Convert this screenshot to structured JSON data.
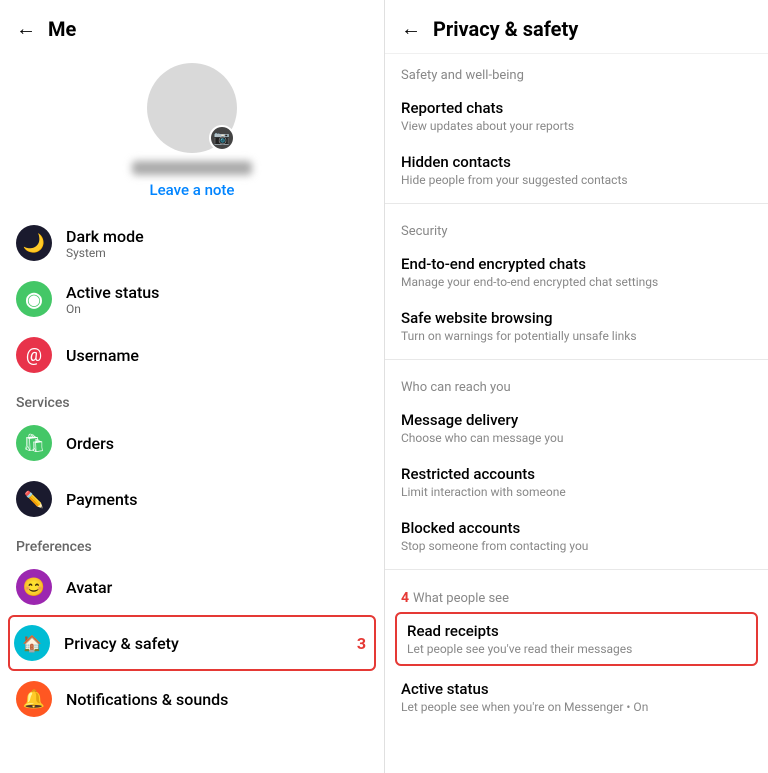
{
  "left": {
    "back_label": "←",
    "title": "Me",
    "leave_note": "Leave a note",
    "items": [
      {
        "id": "dark-mode",
        "title": "Dark mode",
        "sub": "System",
        "icon": "🌙",
        "icon_class": "icon-dark"
      },
      {
        "id": "active-status",
        "title": "Active status",
        "sub": "On",
        "icon": "⊙",
        "icon_class": "icon-green"
      },
      {
        "id": "username",
        "title": "Username",
        "sub": "",
        "icon": "@",
        "icon_class": "icon-red"
      }
    ],
    "sections": {
      "services": {
        "label": "Services",
        "items": [
          {
            "id": "orders",
            "title": "Orders",
            "sub": "",
            "icon": "🛍",
            "icon_class": "icon-shop"
          },
          {
            "id": "payments",
            "title": "Payments",
            "sub": "",
            "icon": "✏",
            "icon_class": "icon-pay"
          }
        ]
      },
      "preferences": {
        "label": "Preferences",
        "items": [
          {
            "id": "avatar",
            "title": "Avatar",
            "sub": "",
            "icon": "😊",
            "icon_class": "icon-avatar"
          },
          {
            "id": "privacy",
            "title": "Privacy & safety",
            "sub": "",
            "icon": "🏠",
            "icon_class": "icon-privacy",
            "highlighted": true,
            "step": "3"
          },
          {
            "id": "notifications",
            "title": "Notifications & sounds",
            "sub": "",
            "icon": "🔔",
            "icon_class": "icon-notif"
          }
        ]
      }
    }
  },
  "right": {
    "back_label": "←",
    "title": "Privacy & safety",
    "sections": [
      {
        "id": "safety",
        "label": "Safety and well-being",
        "items": [
          {
            "id": "reported-chats",
            "title": "Reported chats",
            "sub": "View updates about your reports"
          },
          {
            "id": "hidden-contacts",
            "title": "Hidden contacts",
            "sub": "Hide people from your suggested contacts"
          }
        ]
      },
      {
        "id": "security",
        "label": "Security",
        "items": [
          {
            "id": "e2e-chats",
            "title": "End-to-end encrypted chats",
            "sub": "Manage your end-to-end encrypted chat settings"
          },
          {
            "id": "safe-browsing",
            "title": "Safe website browsing",
            "sub": "Turn on warnings for potentially unsafe links"
          }
        ]
      },
      {
        "id": "who-can-reach",
        "label": "Who can reach you",
        "items": [
          {
            "id": "message-delivery",
            "title": "Message delivery",
            "sub": "Choose who can message you"
          },
          {
            "id": "restricted-accounts",
            "title": "Restricted accounts",
            "sub": "Limit interaction with someone"
          },
          {
            "id": "blocked-accounts",
            "title": "Blocked accounts",
            "sub": "Stop someone from contacting you"
          }
        ]
      },
      {
        "id": "what-people-see",
        "label": "What people see",
        "step_label": "4",
        "items": [
          {
            "id": "read-receipts",
            "title": "Read receipts",
            "sub": "Let people see you've read their messages",
            "highlighted": true
          },
          {
            "id": "active-status",
            "title": "Active status",
            "sub": "Let people see when you're on Messenger • On"
          }
        ]
      }
    ]
  }
}
